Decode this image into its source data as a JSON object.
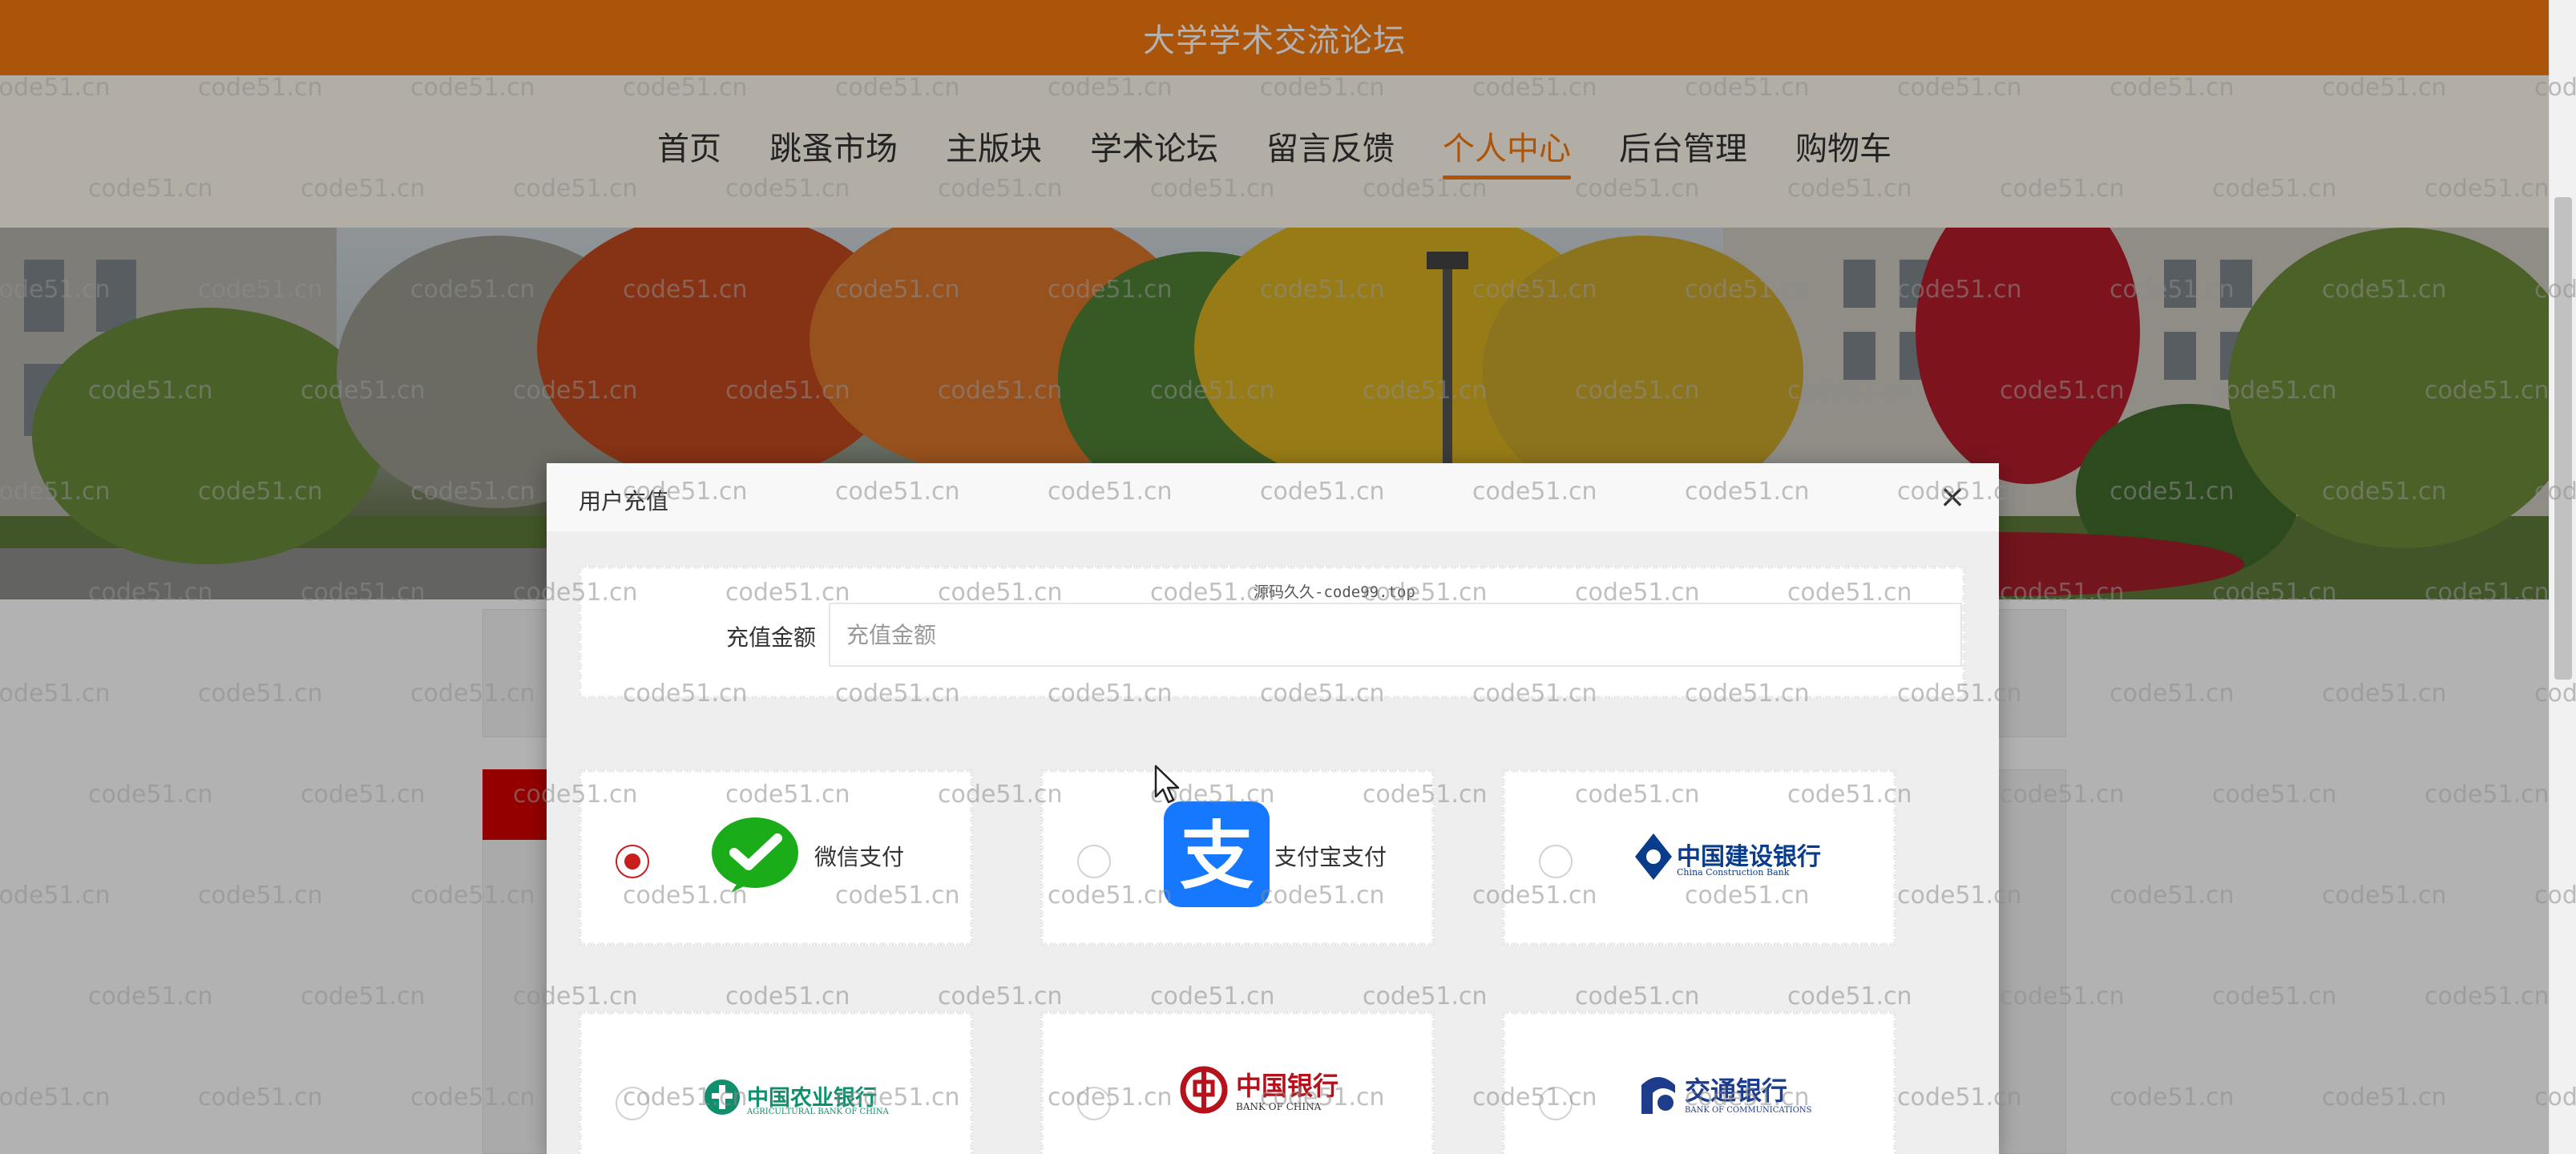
{
  "site": {
    "title": "大学学术交流论坛"
  },
  "nav": {
    "items": [
      {
        "label": "首页"
      },
      {
        "label": "跳蚤市场"
      },
      {
        "label": "主版块"
      },
      {
        "label": "学术论坛"
      },
      {
        "label": "留言反馈"
      },
      {
        "label": "个人中心",
        "active": true
      },
      {
        "label": "后台管理"
      },
      {
        "label": "购物车"
      }
    ]
  },
  "watermark": {
    "text": "code51.cn"
  },
  "modal": {
    "title": "用户充值",
    "close_symbol": "×",
    "watermark_small": "源码久久-code99.top",
    "amount": {
      "label": "充值金额",
      "placeholder": "充值金额",
      "value": ""
    },
    "payment_methods": [
      {
        "label": "微信支付",
        "selected": true,
        "icon": "wechat-pay-icon"
      },
      {
        "label": "支付宝支付",
        "selected": false,
        "icon": "alipay-icon"
      },
      {
        "label": "中国建设银行",
        "sublabel": "China Construction Bank",
        "selected": false,
        "icon": "ccb-logo-icon"
      },
      {
        "label": "中国农业银行",
        "sublabel": "AGRICULTURAL BANK OF CHINA",
        "selected": false,
        "icon": "abc-logo-icon"
      },
      {
        "label": "中国银行",
        "sublabel": "BANK OF CHINA",
        "selected": false,
        "icon": "boc-logo-icon"
      },
      {
        "label": "交通银行",
        "sublabel": "BANK OF COMMUNICATIONS",
        "selected": false,
        "icon": "bocom-logo-icon"
      }
    ]
  },
  "colors": {
    "brand": "#f57a0f",
    "nav_bg": "#fff8ec",
    "wechat_green": "#1aad19",
    "alipay_blue": "#1677ff",
    "ccb_blue": "#0a3c8c",
    "abc_green": "#0f8f6e",
    "boc_red": "#b5121b",
    "bocom_blue": "#1e3c8c",
    "radio_selected": "#c81e1e"
  }
}
